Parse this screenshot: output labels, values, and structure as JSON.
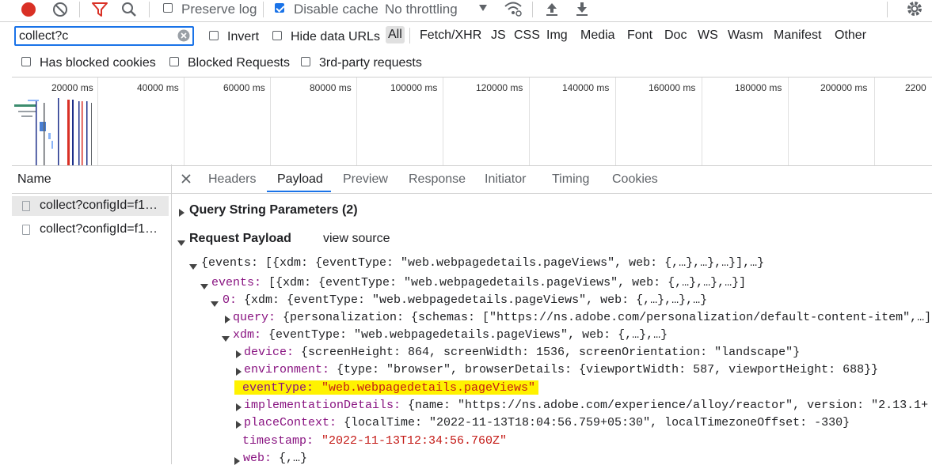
{
  "toolbar": {
    "preserve_log_label": "Preserve log",
    "disable_cache_label": "Disable cache",
    "throttling_label": "No throttling"
  },
  "filter": {
    "value": "collect?c",
    "invert_label": "Invert",
    "hide_data_urls_label": "Hide data URLs",
    "types": [
      "All",
      "Fetch/XHR",
      "JS",
      "CSS",
      "Img",
      "Media",
      "Font",
      "Doc",
      "WS",
      "Wasm",
      "Manifest",
      "Other"
    ],
    "has_blocked_cookies_label": "Has blocked cookies",
    "blocked_requests_label": "Blocked Requests",
    "third_party_label": "3rd-party requests"
  },
  "overview": {
    "ticks": [
      "20000 ms",
      "40000 ms",
      "60000 ms",
      "80000 ms",
      "100000 ms",
      "120000 ms",
      "140000 ms",
      "160000 ms",
      "180000 ms",
      "200000 ms",
      "2200"
    ]
  },
  "requests": {
    "header": "Name",
    "items": [
      "collect?configId=f1…",
      "collect?configId=f1…"
    ]
  },
  "detail": {
    "tabs": [
      "Headers",
      "Payload",
      "Preview",
      "Response",
      "Initiator",
      "Timing",
      "Cookies"
    ],
    "query_string_label": "Query String Parameters (2)",
    "request_payload_label": "Request Payload",
    "view_source_label": "view source",
    "lines": {
      "l1_key": "{events: [{xdm: {eventType: \"web.webpagedetails.pageViews\", web: {,…},…},…}],…}",
      "l2_key": "events:",
      "l2_val": " [{xdm: {eventType: \"web.webpagedetails.pageViews\", web: {,…},…},…}]",
      "l3_key": "0:",
      "l3_val": " {xdm: {eventType: \"web.webpagedetails.pageViews\", web: {,…},…},…}",
      "l4_key": "query:",
      "l4_val": " {personalization: {schemas: [\"https://ns.adobe.com/personalization/default-content-item\",…]}}",
      "l5_key": "xdm:",
      "l5_val": " {eventType: \"web.webpagedetails.pageViews\", web: {,…},…}",
      "l6_key": "device:",
      "l6_val": " {screenHeight: 864, screenWidth: 1536, screenOrientation: \"landscape\"}",
      "l7_key": "environment:",
      "l7_val": " {type: \"browser\", browserDetails: {viewportWidth: 587, viewportHeight: 688}}",
      "l8_key": "eventType:",
      "l8_val": "\"web.webpagedetails.pageViews\"",
      "l9_key": "implementationDetails:",
      "l9_val": " {name: \"https://ns.adobe.com/experience/alloy/reactor\", version: \"2.13.1+",
      "l10_key": "placeContext:",
      "l10_val": " {localTime: \"2022-11-13T18:04:56.759+05:30\", localTimezoneOffset: -330}",
      "l11_key": "timestamp:",
      "l11_val": "\"2022-11-13T12:34:56.760Z\"",
      "l12_key": "web:",
      "l12_val": " {,…}"
    }
  },
  "colors": {
    "accent": "#1a73e8",
    "record": "#d93025",
    "highlight": "#fff200",
    "key": "#881280",
    "string": "#c41a16"
  }
}
